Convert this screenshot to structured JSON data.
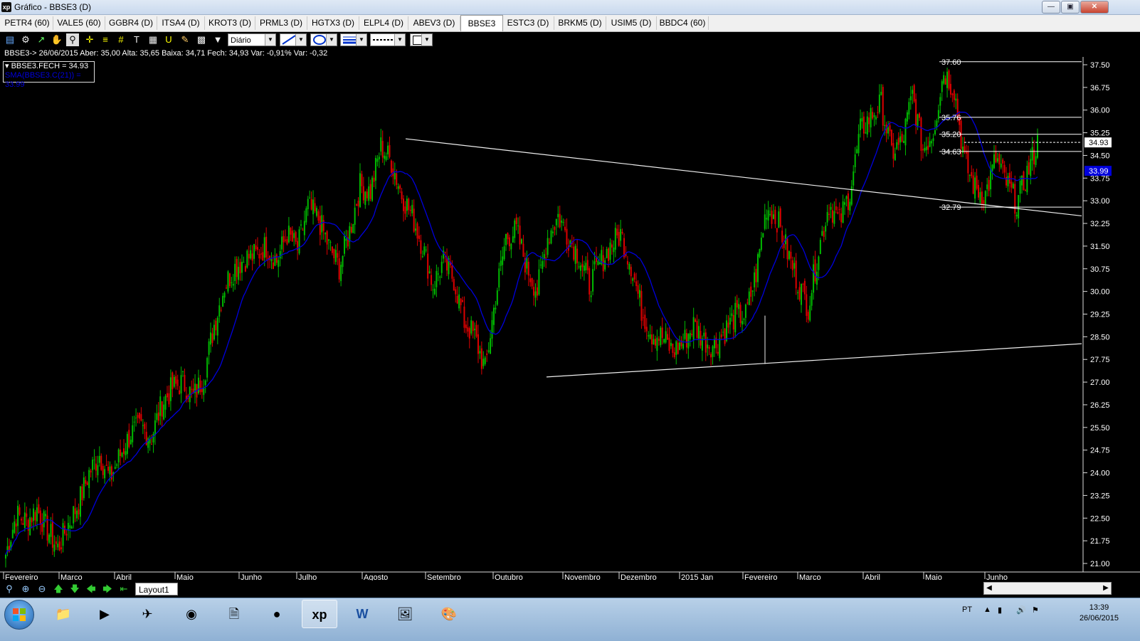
{
  "window": {
    "title": "Gráfico - BBSE3 (D)",
    "app_icon": "xp",
    "buttons": [
      "minimize",
      "maximize",
      "close"
    ]
  },
  "tabs": [
    {
      "label": "PETR4 (60)",
      "active": false
    },
    {
      "label": "VALE5 (60)",
      "active": false
    },
    {
      "label": "GGBR4 (D)",
      "active": false
    },
    {
      "label": "ITSA4 (D)",
      "active": false
    },
    {
      "label": "KROT3 (D)",
      "active": false
    },
    {
      "label": "PRML3 (D)",
      "active": false
    },
    {
      "label": "HGTX3 (D)",
      "active": false
    },
    {
      "label": "ELPL4 (D)",
      "active": false
    },
    {
      "label": "ABEV3 (D)",
      "active": false
    },
    {
      "label": "BBSE3 (D)",
      "active": true
    },
    {
      "label": "ESTC3 (D)",
      "active": false
    },
    {
      "label": "BRKM5 (D)",
      "active": false
    },
    {
      "label": "USIM5 (D)",
      "active": false
    },
    {
      "label": "BBDC4 (60)",
      "active": false
    }
  ],
  "toolbar": {
    "icons": [
      "chart-icon",
      "gear-icon",
      "trendline-icon",
      "hand-icon",
      "zoom-select-icon",
      "crosshair-icon",
      "fibonacci-icon",
      "grid-icon",
      "text-icon",
      "calculator-icon",
      "magnet-icon",
      "brush-icon",
      "clipboard-icon",
      "filter-icon"
    ],
    "period_select": "Diário",
    "line_tool": "line",
    "shape_tool": "ellipse",
    "line_style": "dashed"
  },
  "info_line": "BBSE3-> 26/06/2015 Aber: 35,00 Alta: 35,65 Baixa: 34,71 Fech: 34,93 Var: -0,91% Var: -0,32",
  "legend": {
    "close_label": "BBSE3.FECH = 34.93",
    "sma_label": "SMA(BBSE3.C(21)) = 33.99"
  },
  "colors": {
    "up": "#00bb00",
    "down": "#dd0000",
    "sma": "#0000dd",
    "lines": "#ffffff",
    "background": "#000000"
  },
  "chart_data": {
    "type": "candlestick",
    "symbol": "BBSE3",
    "ylim": [
      20.7,
      37.8
    ],
    "yticks": [
      "37.50",
      "36.75",
      "36.00",
      "35.25",
      "34.50",
      "33.75",
      "33.00",
      "32.25",
      "31.50",
      "30.75",
      "30.00",
      "29.25",
      "28.50",
      "27.75",
      "27.00",
      "26.25",
      "25.50",
      "24.75",
      "24.00",
      "23.25",
      "22.50",
      "21.75",
      "21.00"
    ],
    "xlabels": [
      "Fevereiro",
      "Marco",
      "Abril",
      "Maio",
      "Junho",
      "Julho",
      "Agosto",
      "Setembro",
      "Outubro",
      "Novembro",
      "Dezembro",
      "2015 Jan",
      "Fevereiro",
      "Marco",
      "Abril",
      "Maio",
      "Junho"
    ],
    "last_price": "34.93",
    "sma_value": "33.99",
    "levels": [
      "37.60",
      "35.76",
      "35.20",
      "34.63",
      "32.79"
    ],
    "close_path": [
      21.3,
      22.6,
      22.4,
      22.8,
      22.1,
      21.5,
      22.3,
      23.0,
      24.0,
      24.6,
      23.8,
      24.6,
      25.3,
      25.5,
      25.2,
      26.3,
      26.8,
      27.0,
      26.5,
      27.2,
      28.9,
      30.2,
      30.8,
      31.1,
      31.2,
      31.5,
      31.0,
      31.9,
      31.4,
      32.8,
      32.4,
      31.5,
      30.8,
      32.0,
      33.5,
      33.3,
      34.8,
      34.3,
      33.2,
      32.5,
      31.5,
      30.2,
      31.0,
      30.4,
      29.0,
      28.5,
      27.4,
      29.8,
      31.8,
      32.0,
      30.8,
      30.0,
      31.8,
      32.5,
      31.8,
      31.2,
      30.2,
      30.9,
      31.5,
      31.9,
      30.9,
      29.4,
      28.6,
      28.5,
      28.0,
      28.3,
      28.9,
      28.4,
      28.2,
      28.7,
      29.2,
      29.2,
      30.6,
      32.8,
      32.4,
      31.3,
      30.3,
      29.5,
      31.4,
      32.9,
      32.3,
      33.3,
      35.3,
      35.8,
      36.2,
      34.6,
      34.9,
      36.5,
      34.7,
      35.3,
      37.3,
      36.7,
      34.3,
      33.4,
      33.2,
      34.4,
      33.6,
      32.9,
      33.9,
      34.9
    ]
  }
}
